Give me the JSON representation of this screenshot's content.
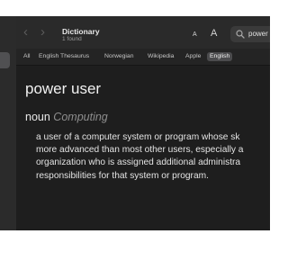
{
  "toolbar": {
    "back_glyph": "‹",
    "forward_glyph": "›",
    "title": "Dictionary",
    "subtitle": "1 found",
    "font_smaller": "A",
    "font_larger": "A"
  },
  "search": {
    "value": "power"
  },
  "tabs": [
    {
      "label": "All",
      "active": false
    },
    {
      "label": "English Thesaurus",
      "active": false
    },
    {
      "label": "Norwegian",
      "active": false
    },
    {
      "label": "Wikipedia",
      "active": false
    },
    {
      "label": "Apple",
      "active": false
    },
    {
      "label": "English",
      "active": true
    }
  ],
  "entry": {
    "headword": "power user",
    "part_of_speech": "noun",
    "domain": "Computing",
    "definition": "a user of a computer system or program whose sk\nmore advanced than most other users, especially a\norganization who is assigned additional administra\nresponsibilities for that system or program."
  },
  "icons": {
    "back": "chevron-left-icon",
    "forward": "chevron-right-icon",
    "search": "search-icon"
  },
  "colors": {
    "window_bg": "#1e1e1e",
    "toolbar_bg": "#2a2a2a",
    "active_tab_bg": "#4b4b4d",
    "domain_label": "#8e8e8e"
  }
}
